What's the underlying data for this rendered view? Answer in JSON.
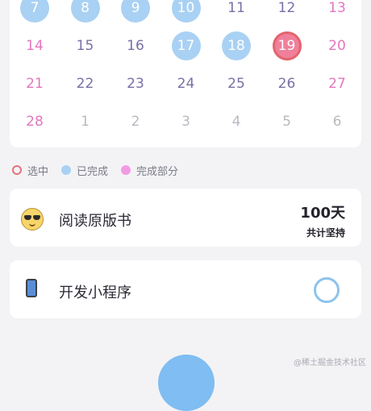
{
  "calendar": {
    "rows": [
      [
        {
          "label": "7",
          "state": "done"
        },
        {
          "label": "8",
          "state": "done"
        },
        {
          "label": "9",
          "state": "done"
        },
        {
          "label": "10",
          "state": "done"
        },
        {
          "label": "11",
          "state": "normal",
          "color": "purple"
        },
        {
          "label": "12",
          "state": "normal",
          "color": "purple"
        },
        {
          "label": "13",
          "state": "normal",
          "color": "pink"
        }
      ],
      [
        {
          "label": "14",
          "state": "normal",
          "color": "pink"
        },
        {
          "label": "15",
          "state": "normal",
          "color": "purple"
        },
        {
          "label": "16",
          "state": "normal",
          "color": "purple"
        },
        {
          "label": "17",
          "state": "done"
        },
        {
          "label": "18",
          "state": "done"
        },
        {
          "label": "19",
          "state": "selected"
        },
        {
          "label": "20",
          "state": "normal",
          "color": "pink"
        }
      ],
      [
        {
          "label": "21",
          "state": "normal",
          "color": "pink"
        },
        {
          "label": "22",
          "state": "normal",
          "color": "purple"
        },
        {
          "label": "23",
          "state": "normal",
          "color": "purple"
        },
        {
          "label": "24",
          "state": "normal",
          "color": "purple"
        },
        {
          "label": "25",
          "state": "normal",
          "color": "purple"
        },
        {
          "label": "26",
          "state": "normal",
          "color": "purple"
        },
        {
          "label": "27",
          "state": "normal",
          "color": "pink"
        }
      ],
      [
        {
          "label": "28",
          "state": "normal",
          "color": "pink"
        },
        {
          "label": "1",
          "state": "normal",
          "color": "gray"
        },
        {
          "label": "2",
          "state": "normal",
          "color": "gray"
        },
        {
          "label": "3",
          "state": "normal",
          "color": "gray"
        },
        {
          "label": "4",
          "state": "normal",
          "color": "gray"
        },
        {
          "label": "5",
          "state": "normal",
          "color": "gray"
        },
        {
          "label": "6",
          "state": "normal",
          "color": "gray"
        }
      ]
    ]
  },
  "legend": {
    "selected": "选中",
    "done": "已完成",
    "partial": "完成部分"
  },
  "tasks": [
    {
      "title": "阅读原版书",
      "icon": "sunglasses-face-icon",
      "days": "100天",
      "days_label": "共计坚持"
    },
    {
      "title": "开发小程序",
      "icon": "phone-icon"
    }
  ],
  "colors": {
    "done": "#a9d1f3",
    "selected": "#f07f9b",
    "weekend": "#e476be",
    "weekday": "#7a6fa6",
    "other_month": "#b9b9c2",
    "accent": "#7fbdf2"
  },
  "watermark": "@稀土掘金技术社区"
}
